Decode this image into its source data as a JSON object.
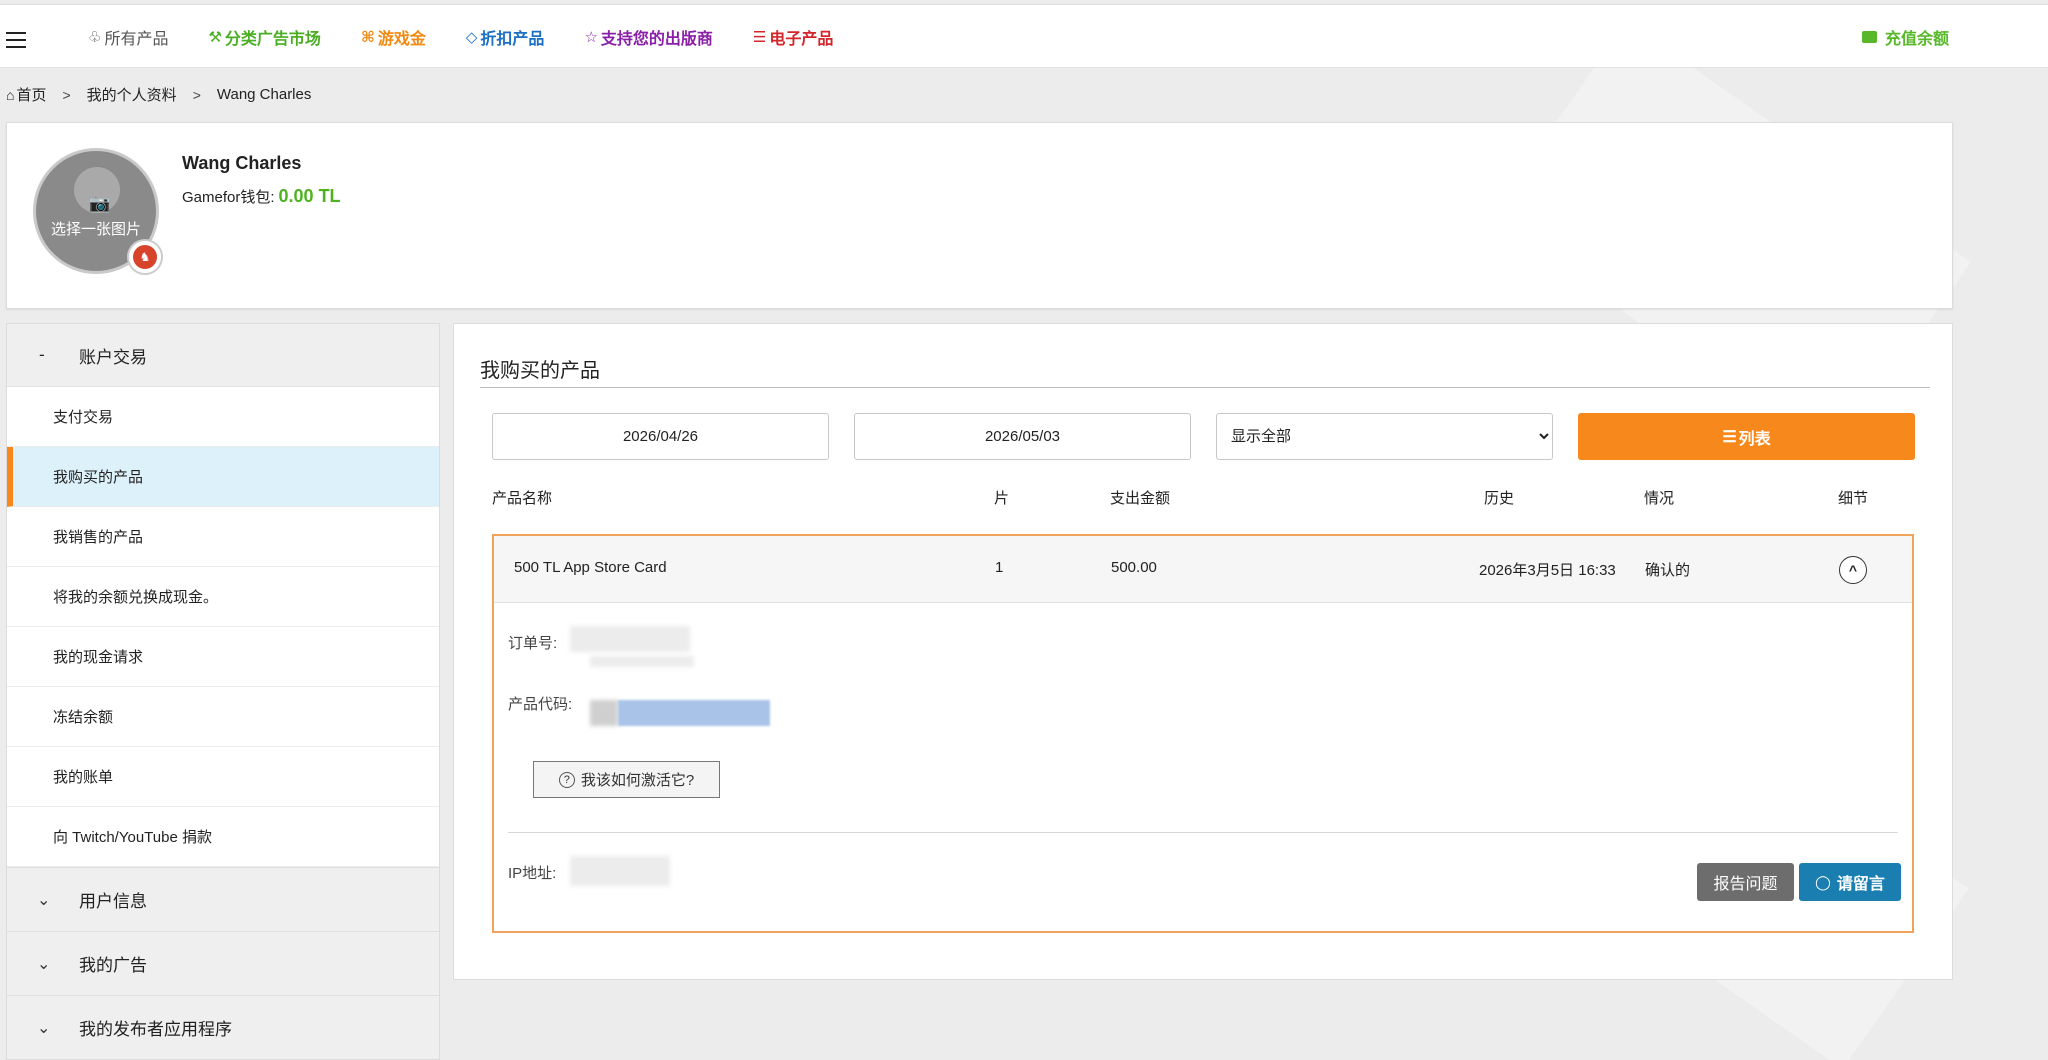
{
  "nav": {
    "items": [
      {
        "icon": "people-icon",
        "glyph": "♧",
        "label": "所有产品",
        "color": "#555555"
      },
      {
        "icon": "hammer-icon",
        "glyph": "⚒",
        "label": "分类广告市场",
        "color": "#4aae22"
      },
      {
        "icon": "gamepad-icon",
        "glyph": "⌘",
        "label": "游戏金",
        "color": "#f08a12"
      },
      {
        "icon": "tag-icon",
        "glyph": "◇",
        "label": "折扣产品",
        "color": "#1c6fc4"
      },
      {
        "icon": "star-icon",
        "glyph": "☆",
        "label": "支持您的出版商",
        "color": "#8a1fa8"
      },
      {
        "icon": "coins-icon",
        "glyph": "☰",
        "label": "电子产品",
        "color": "#d3262a"
      }
    ],
    "recharge": "充值余额",
    "accent": "#58b82a"
  },
  "breadcrumb": {
    "home": "首页",
    "profile": "我的个人资料",
    "user": "Wang Charles"
  },
  "profile": {
    "pick_image": "选择一张图片",
    "name": "Wang Charles",
    "wallet_label": "Gamefor钱包:",
    "wallet_amount": "0.00 TL"
  },
  "sidebar": {
    "section_marker": "-",
    "section_title": "账户交易",
    "items": [
      "支付交易",
      "我购买的产品",
      "我销售的产品",
      "将我的余额兑换成现金。",
      "我的现金请求",
      "冻结余额",
      "我的账单",
      "向 Twitch/YouTube 捐款"
    ],
    "active_index": 1,
    "groups": [
      "用户信息",
      "我的广告",
      "我的发布者应用程序"
    ]
  },
  "main": {
    "title": "我购买的产品",
    "date_from": "2026/04/26",
    "date_to": "2026/05/03",
    "filter_selected": "显示全部",
    "list_button": "列表",
    "columns": {
      "name": "产品名称",
      "qty": "片",
      "amount": "支出金额",
      "history": "历史",
      "status": "情况",
      "detail": "细节"
    },
    "order": {
      "name": "500 TL App Store Card",
      "qty": "1",
      "amount": "500.00",
      "date": "2026年3月5日 16:33",
      "status": "确认的",
      "order_no_label": "订单号:",
      "code_label": "产品代码:",
      "howto": "我该如何激活它?",
      "ip_label": "IP地址:",
      "report": "报告问题",
      "message": "请留言"
    },
    "accent": "#f7891c"
  }
}
